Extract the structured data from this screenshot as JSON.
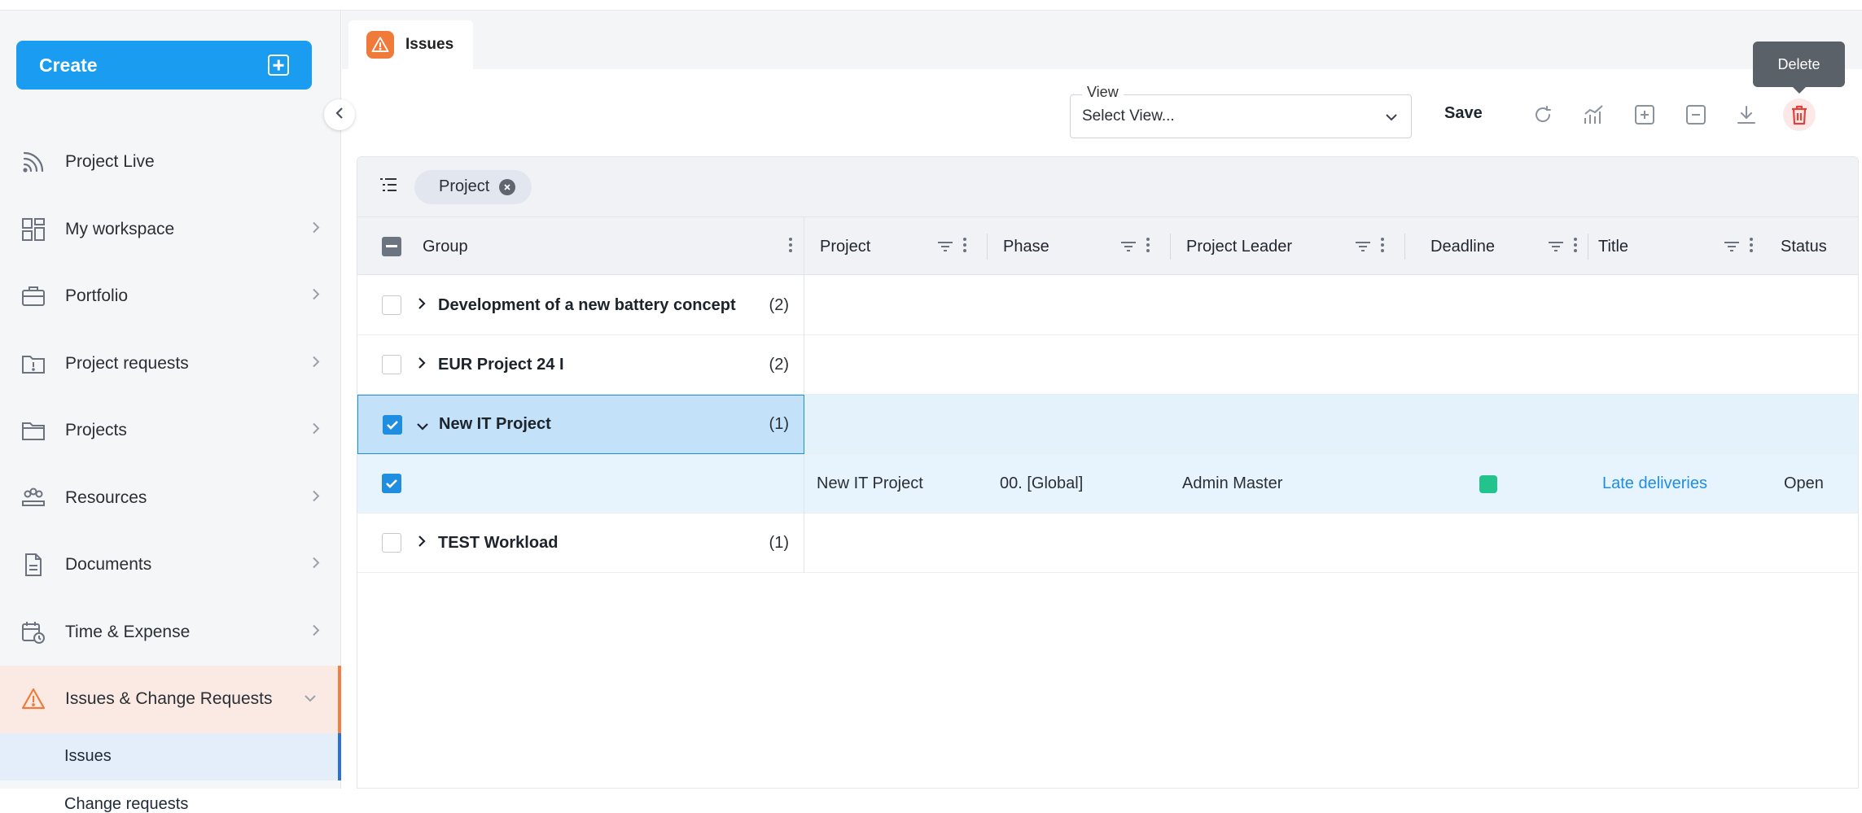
{
  "sidebar": {
    "create_label": "Create",
    "items": [
      {
        "label": "Project Live",
        "icon": "rss-icon"
      },
      {
        "label": "My workspace",
        "icon": "dashboard-icon"
      },
      {
        "label": "Portfolio",
        "icon": "briefcase-icon"
      },
      {
        "label": "Project requests",
        "icon": "folder-alert-icon"
      },
      {
        "label": "Projects",
        "icon": "folder-icon"
      },
      {
        "label": "Resources",
        "icon": "people-icon"
      },
      {
        "label": "Documents",
        "icon": "document-icon"
      },
      {
        "label": "Time & Expense",
        "icon": "calendar-clock-icon"
      },
      {
        "label": "Issues & Change Requests",
        "icon": "warning-icon"
      }
    ],
    "sub_items": [
      {
        "label": "Issues"
      },
      {
        "label": "Change requests"
      }
    ]
  },
  "tab": {
    "label": "Issues",
    "icon": "warning-icon"
  },
  "toolbar": {
    "view_legend": "View",
    "view_value": "Select View...",
    "save_label": "Save",
    "tooltip": "Delete"
  },
  "grouping": {
    "chip_label": "Project"
  },
  "columns": {
    "group": "Group",
    "project": "Project",
    "phase": "Phase",
    "leader": "Project Leader",
    "deadline": "Deadline",
    "title": "Title",
    "status": "Status"
  },
  "rows": [
    {
      "type": "group",
      "name": "Development of a new battery concept",
      "count": "(2)",
      "expanded": false,
      "checked": false
    },
    {
      "type": "group",
      "name": "EUR Project 24 I",
      "count": "(2)",
      "expanded": false,
      "checked": false
    },
    {
      "type": "group",
      "name": "New IT Project",
      "count": "(1)",
      "expanded": true,
      "checked": true
    },
    {
      "type": "data",
      "project": "New IT Project",
      "phase": "00. [Global]",
      "leader": "Admin Master",
      "deadline_color": "#23c38e",
      "title": "Late deliveries",
      "status": "Open",
      "checked": true
    },
    {
      "type": "group",
      "name": "TEST Workload",
      "count": "(1)",
      "expanded": false,
      "checked": false
    }
  ],
  "colors": {
    "accent": "#1a9cf0",
    "issue_orange": "#f07a3a",
    "selected_row": "#c3e2fa"
  }
}
